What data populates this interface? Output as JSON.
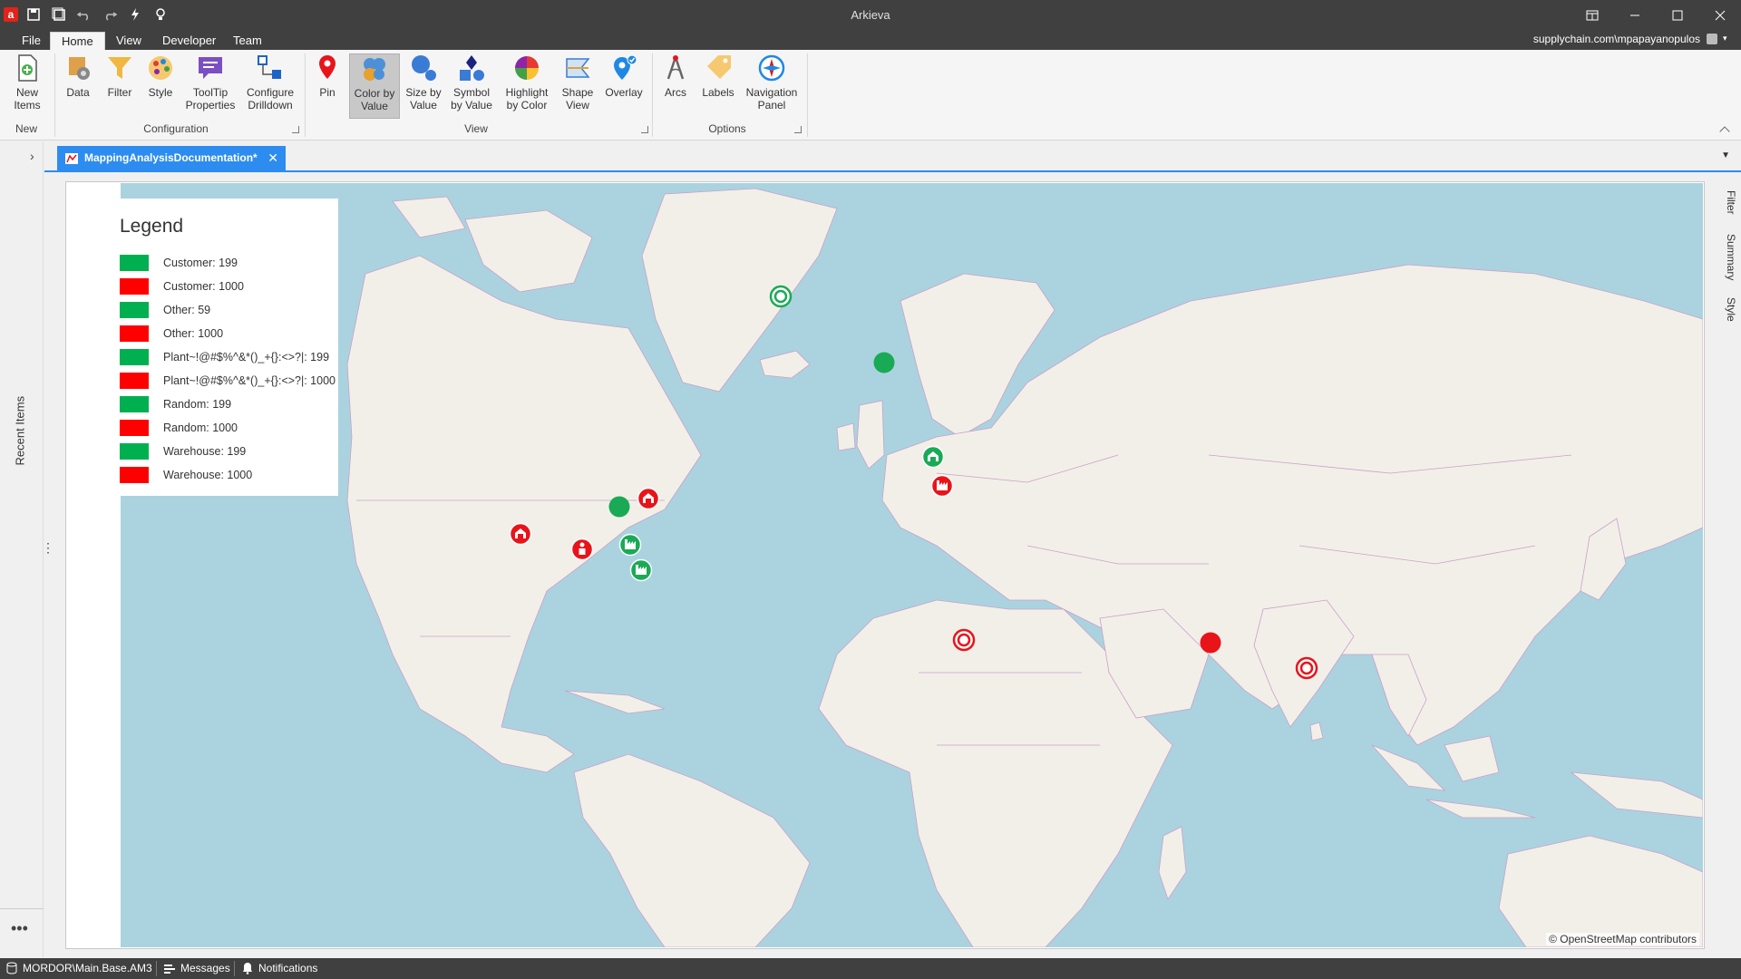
{
  "window": {
    "app_logo": "a",
    "title": "Arkieva"
  },
  "ribbon_tabs": {
    "file": "File",
    "home": "Home",
    "view": "View",
    "developer": "Developer",
    "team": "Team"
  },
  "user": {
    "account": "supplychain.com\\mpapayanopulos"
  },
  "ribbon": {
    "new_items": "New Items",
    "data": "Data",
    "filter": "Filter",
    "style": "Style",
    "tooltip_properties": "ToolTip Properties",
    "configure_drilldown": "Configure Drilldown",
    "pin": "Pin",
    "color_by_value": "Color by Value",
    "size_by_value": "Size by Value",
    "symbol_by_value": "Symbol by Value",
    "highlight_by_color": "Highlight by Color",
    "shape_view": "Shape View",
    "overlay": "Overlay",
    "arcs": "Arcs",
    "labels": "Labels",
    "navigation_panel": "Navigation Panel",
    "group_new": "New",
    "group_configuration": "Configuration",
    "group_view": "View",
    "group_options": "Options"
  },
  "left_panel": {
    "recent_items": "Recent Items"
  },
  "document_tab": {
    "label": "MappingAnalysisDocumentation*"
  },
  "right_panel": {
    "filter": "Filter",
    "summary": "Summary",
    "style": "Style"
  },
  "legend": {
    "title": "Legend",
    "items": [
      {
        "label": "Customer: 199",
        "color": "#00b050"
      },
      {
        "label": "Customer: 1000",
        "color": "#ff0000"
      },
      {
        "label": "Other: 59",
        "color": "#00b050"
      },
      {
        "label": "Other: 1000",
        "color": "#ff0000"
      },
      {
        "label": "Plant~!@#$%^&*()_+{}:<>?|: 199",
        "color": "#00b050"
      },
      {
        "label": "Plant~!@#$%^&*()_+{}:<>?|: 1000",
        "color": "#ff0000"
      },
      {
        "label": "Random: 199",
        "color": "#00b050"
      },
      {
        "label": "Random: 1000",
        "color": "#ff0000"
      },
      {
        "label": "Warehouse: 199",
        "color": "#00b050"
      },
      {
        "label": "Warehouse: 1000",
        "color": "#ff0000"
      }
    ]
  },
  "map": {
    "attribution": "© OpenStreetMap contributors",
    "colors": {
      "green": "#1aaa55",
      "red": "#e8141a",
      "water": "#aad3df",
      "land": "#f2efe9",
      "border": "#c9a0c9"
    },
    "markers": [
      {
        "kind": "ring",
        "color": "green",
        "place": "Greenland"
      },
      {
        "kind": "dot",
        "color": "green",
        "place": "Iceland"
      },
      {
        "kind": "warehouse",
        "color": "green",
        "place": "United Kingdom"
      },
      {
        "kind": "plant",
        "color": "red",
        "place": "France"
      },
      {
        "kind": "dot",
        "color": "green",
        "place": "US Midwest"
      },
      {
        "kind": "warehouse",
        "color": "red",
        "place": "US Northeast"
      },
      {
        "kind": "warehouse",
        "color": "red",
        "place": "US West Coast"
      },
      {
        "kind": "customer",
        "color": "red",
        "place": "Texas"
      },
      {
        "kind": "plant",
        "color": "green",
        "place": "US Southeast"
      },
      {
        "kind": "plant",
        "color": "green",
        "place": "Florida"
      },
      {
        "kind": "ring",
        "color": "red",
        "place": "West Africa"
      },
      {
        "kind": "dot",
        "color": "red",
        "place": "Sri Lanka"
      },
      {
        "kind": "ring",
        "color": "red",
        "place": "Singapore"
      }
    ]
  },
  "statusbar": {
    "database": "MORDOR\\Main.Base.AM3",
    "messages": "Messages",
    "notifications": "Notifications"
  }
}
